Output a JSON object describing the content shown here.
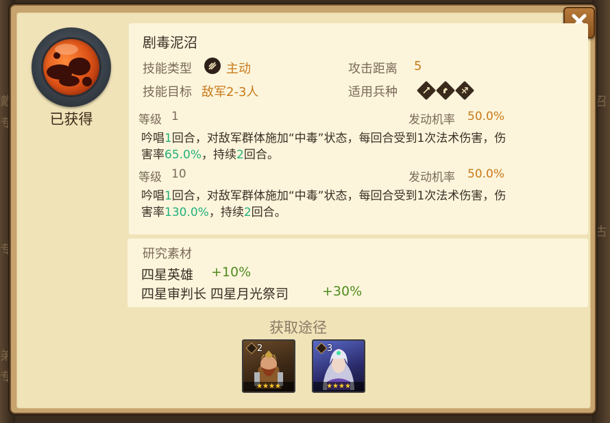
{
  "background": {
    "left_texts": [
      "戴",
      "专",
      "弟",
      "专",
      "专"
    ],
    "right_texts": [
      "召",
      "古"
    ]
  },
  "close_button": {
    "icon": "close-icon"
  },
  "skill": {
    "obtained_label": "已获得",
    "name": "剧毒泥沼",
    "type_label": "技能类型",
    "type_value": "主动",
    "range_label": "攻击距离",
    "range_value": "5",
    "target_label": "技能目标",
    "target_value": "敌军2-3人",
    "troop_label": "适用兵种",
    "troop_icons": [
      "infantry-icon",
      "cavalry-icon",
      "archer-icon"
    ]
  },
  "levels": [
    {
      "level_label": "等级",
      "level_value": "1",
      "rate_label": "发动机率",
      "rate_value": "50.0%",
      "desc": {
        "p1": "吟唱",
        "rounds1": "1",
        "p2": "回合，对敌军群体施加“中毒”状态，每回合受到1次法术伤害，伤",
        "p3": "害率",
        "dmg": "65.0%",
        "p4": "，持续",
        "dur": "2",
        "p5": "回合。"
      }
    },
    {
      "level_label": "等级",
      "level_value": "10",
      "rate_label": "发动机率",
      "rate_value": "50.0%",
      "desc": {
        "p1": "吟唱",
        "rounds1": "1",
        "p2": "回合，对敌军群体施加“中毒”状态，每回合受到1次法术伤害，伤",
        "p3": "害率",
        "dmg": "130.0%",
        "p4": "，持续",
        "dur": "2",
        "p5": "回合。"
      }
    }
  ],
  "research": {
    "title": "研究素材",
    "rows": [
      {
        "name": "四星英雄",
        "bonus": "+10%"
      },
      {
        "name": "四星审判长 四星月光祭司",
        "bonus": "+30%"
      }
    ]
  },
  "acquire": {
    "title": "获取途径",
    "heroes": [
      {
        "name": "dwarf-hero",
        "level": "2",
        "stars": 4,
        "stars_label": "★★★★"
      },
      {
        "name": "elf-priestess-hero",
        "level": "3",
        "stars": 4,
        "stars_label": "★★★★"
      }
    ]
  },
  "colors": {
    "accent_orange": "#c87a1a",
    "value_green": "#22b07a",
    "bonus_green": "#4f8a1e",
    "panel": "#f0e3b8",
    "card": "#fcf5dc"
  }
}
